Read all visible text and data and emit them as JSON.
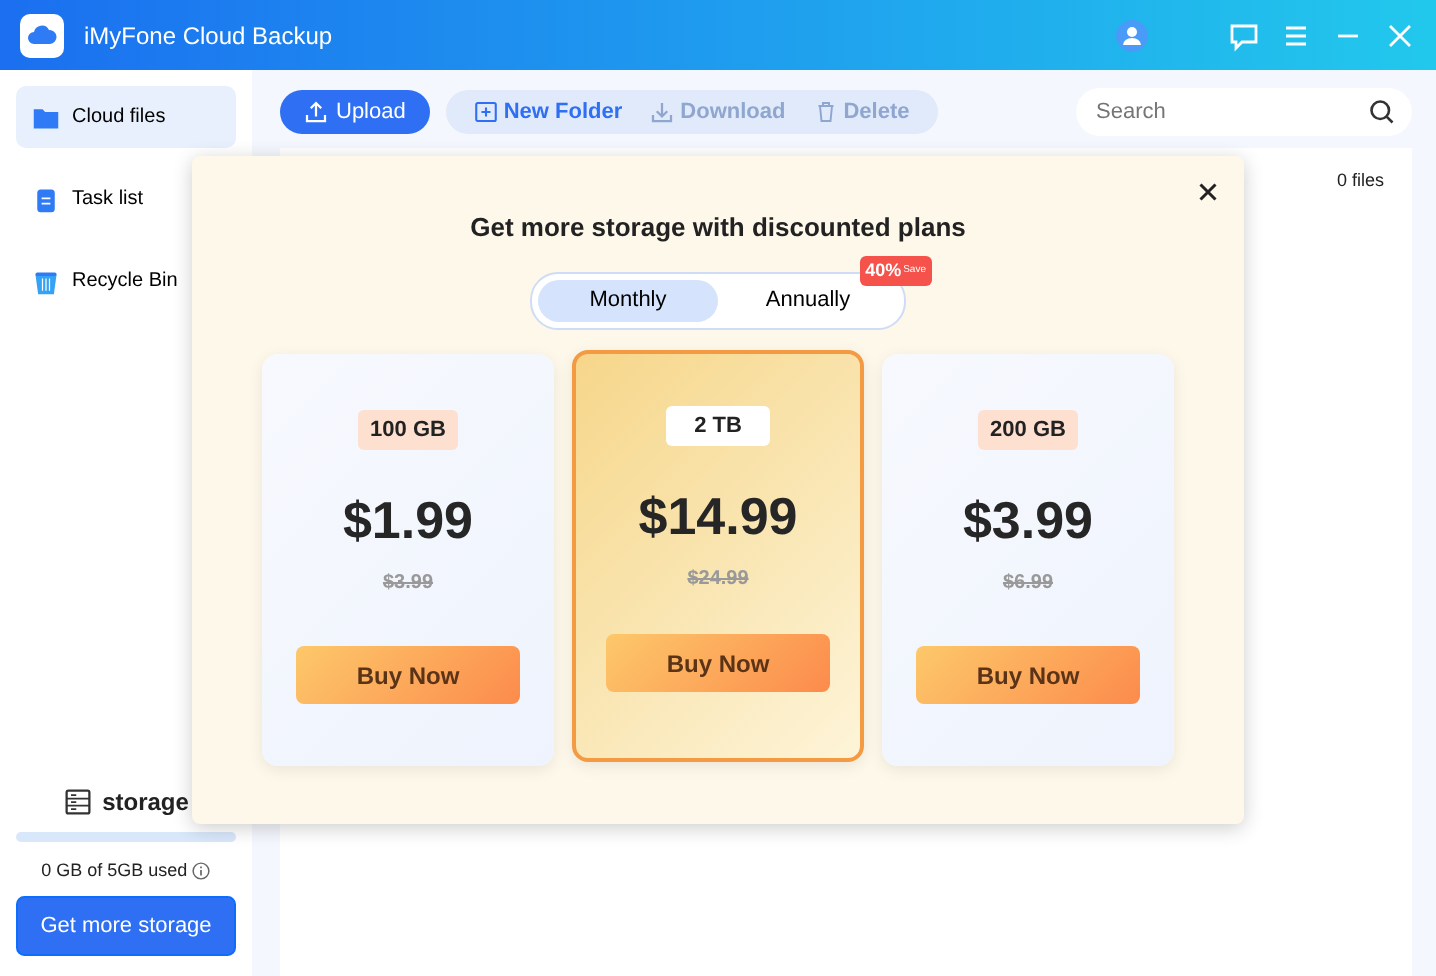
{
  "window": {
    "title": "iMyFone Cloud Backup"
  },
  "sidebar": {
    "items": [
      {
        "label": "Cloud files",
        "selected": true
      },
      {
        "label": "Task list",
        "selected": false
      },
      {
        "label": "Recycle Bin",
        "selected": false
      }
    ],
    "storage": {
      "label": "storage",
      "level": 0.0,
      "usage": "0 GB of 5GB used",
      "button": "Get more storage"
    }
  },
  "toolbar": {
    "upload": "Upload",
    "actions": [
      {
        "label": "New Folder",
        "disabled": false
      },
      {
        "label": "Download",
        "disabled": true
      },
      {
        "label": "Delete",
        "disabled": true
      }
    ],
    "search": {
      "placeholder": "Search"
    }
  },
  "file_count": "0 files",
  "dialog": {
    "title": "Get more storage with discounted plans",
    "billing": [
      {
        "label": "Monthly",
        "selected": true
      },
      {
        "label": "Annually",
        "selected": false
      }
    ],
    "discount_badge": {
      "value": "40%",
      "caption": "Save"
    },
    "plans": [
      {
        "size": "100 GB",
        "price": "$1.99",
        "old_price": "$3.99",
        "button": "Buy Now",
        "selected": false
      },
      {
        "size": "2 TB",
        "price": "$14.99",
        "old_price": "$24.99",
        "button": "Buy Now",
        "selected": true
      },
      {
        "size": "200 GB",
        "price": "$3.99",
        "old_price": "$6.99",
        "button": "Buy Now",
        "selected": false
      }
    ]
  }
}
